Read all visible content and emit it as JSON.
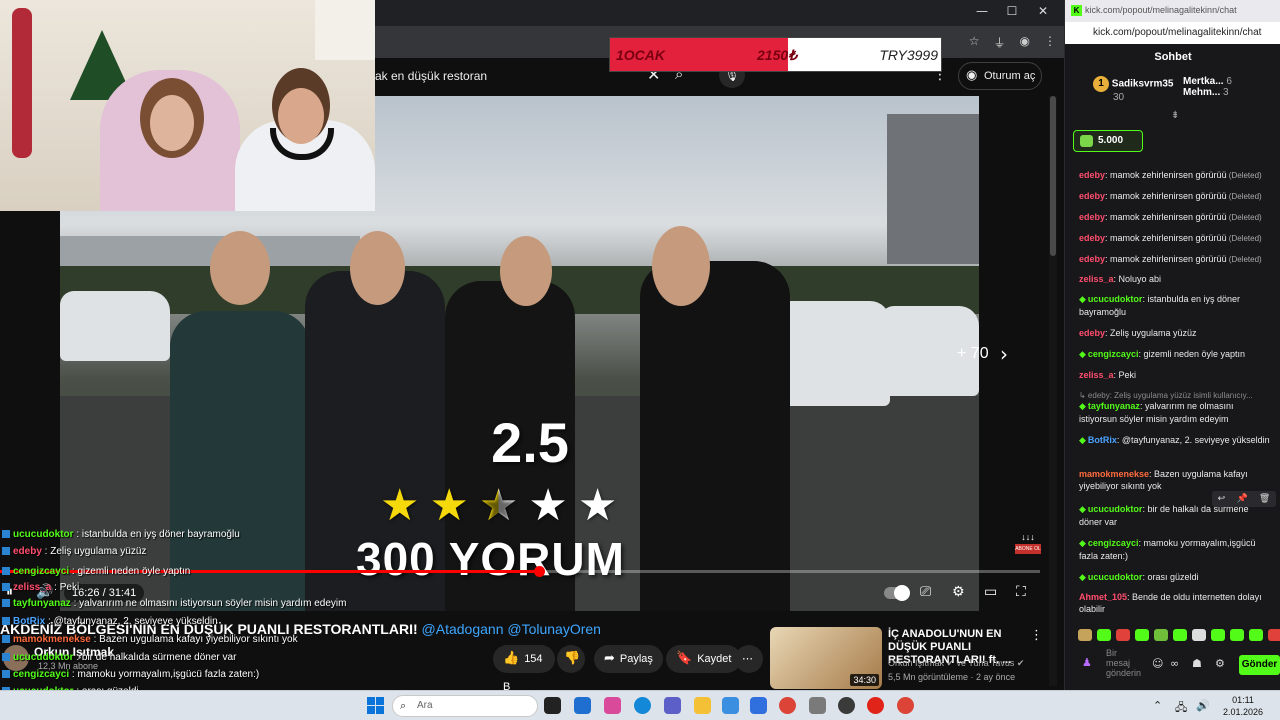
{
  "browser": {
    "window_controls": [
      "—",
      "☐",
      "✕"
    ],
    "toolbar_icons": [
      "☆",
      "⏚",
      "◉",
      "⋮"
    ]
  },
  "youtube": {
    "search_query": "ak en düşük restoran",
    "signin_label": "Oturum aç",
    "video": {
      "rating": "2.5",
      "stars": {
        "full": 2,
        "half": 1,
        "empty": 2
      },
      "reviews_text": "300 YORUM",
      "more_count": "+ 70",
      "subscribe_watermark": "ABONE OL",
      "time": "16:26 / 31:41",
      "progress_fraction": 0.518
    },
    "title_main": "AKDENİZ BÖLGESİ'NİN EN DÜŞÜK PUANLI RESTORANTLARI!",
    "title_mentions": "@Atadogann @TolunayOren",
    "channel": {
      "name": "Orkun Işıtmak",
      "subs": "12,3 Mn abone"
    },
    "actions": {
      "like_count": "154 B",
      "share": "Paylaş",
      "save": "Kaydet"
    },
    "recommendation": {
      "title": "İÇ ANADOLU'NUN EN DÜŞÜK PUANLI RESTORANTLARI! ft. ...",
      "channel": "Orkun Işıtmak ✔ ve Tuna Tavus ✔",
      "meta": "5,5 Mn görüntüleme · 2 ay önce",
      "duration": "34:30"
    }
  },
  "donation": {
    "month": "1OCAK",
    "amount": "2150₺",
    "goal": "TRY3999",
    "fraction": 0.5377,
    "color": "#e3213d"
  },
  "stream_overlay_chat": [
    {
      "user": "ucucudoktor",
      "text": ": istanbulda en iyş döner bayramoğlu",
      "color": "#53fc18"
    },
    {
      "user": "edeby",
      "text": ": Zeliş uygulama yüzüz",
      "color": "#ff4d6d"
    },
    {
      "user": "cengizcayci",
      "text": ": gizemli neden öyle yaptın",
      "color": "#53fc18"
    },
    {
      "user": "zeliss_a",
      "text": ": Peki",
      "color": "#ff4d6d"
    },
    {
      "user": "tayfunyanaz",
      "text": ": yalvarırım ne olmasını istiyorsun söyler misin yardım edeyim",
      "color": "#53fc18"
    },
    {
      "user": "BotRix",
      "text": ": @tayfunyanaz, 2. seviyeye yükseldin",
      "color": "#4aa3ff"
    },
    {
      "user": "mamokmenekse",
      "text": ": Bazen uygulama kafayı yiyebiliyor sıkıntı yok",
      "color": "#ff6b3d"
    },
    {
      "user": "ucucudoktor",
      "text": ": bir de halkalıda sürmene döner var",
      "color": "#53fc18"
    },
    {
      "user": "cengizcayci",
      "text": ": mamoku yormayalım,işgücü fazla zaten:)",
      "color": "#53fc18"
    },
    {
      "user": "ucucudoktor",
      "text": ": orası güzeldi",
      "color": "#53fc18"
    },
    {
      "user": "Ahmet_105",
      "text": ": Bende de oldu internetten dolayı olabilir",
      "color": "#ff4d6d"
    }
  ],
  "kick": {
    "url_top": "kick.com/popout/melinagalitekinn/chat",
    "url": "kick.com/popout/melinagalitekinn/chat",
    "header": "Sohbet",
    "leaderboard": [
      {
        "rank": "1",
        "name": "Sadiksvrm35",
        "value": "30"
      },
      {
        "name": "Mertka...",
        "value": "6"
      },
      {
        "name": "Mehm...",
        "value": "3"
      }
    ],
    "gift_amount": "5.000",
    "messages": [
      {
        "user": "edeby",
        "text": ": mamok zehirlenirsen görürüü",
        "deleted": "(Deleted)",
        "color": "#ff4d6d"
      },
      {
        "user": "edeby",
        "text": ": mamok zehirlenirsen görürüü",
        "deleted": "(Deleted)",
        "color": "#ff4d6d"
      },
      {
        "user": "edeby",
        "text": ": mamok zehirlenirsen görürüü",
        "deleted": "(Deleted)",
        "color": "#ff4d6d"
      },
      {
        "user": "edeby",
        "text": ": mamok zehirlenirsen görürüü",
        "deleted": "(Deleted)",
        "color": "#ff4d6d"
      },
      {
        "user": "edeby",
        "text": ": mamok zehirlenirsen görürüü",
        "deleted": "(Deleted)",
        "color": "#ff4d6d"
      },
      {
        "user": "zeliss_a",
        "text": ": Noluyo abi",
        "color": "#ff4d6d"
      },
      {
        "user": "ucucudoktor",
        "text": ": istanbulda en iyş döner bayramoğlu",
        "color": "#53fc18"
      },
      {
        "user": "edeby",
        "text": ": Zeliş uygulama yüzüz",
        "color": "#ff4d6d"
      },
      {
        "user": "cengizcayci",
        "text": ": gizemli neden öyle yaptın",
        "color": "#53fc18"
      },
      {
        "user": "zeliss_a",
        "text": ": Peki",
        "color": "#ff4d6d"
      },
      {
        "reply": "↳ edeby: Zeliş uygulama yüzüz isimli kullanıcıy..."
      },
      {
        "user": "tayfunyanaz",
        "text": ": yalvarırım ne olmasını istiyorsun söyler misin yardım edeyim",
        "color": "#53fc18"
      },
      {
        "user": "BotRix",
        "text": ": @tayfunyanaz, 2. seviyeye yükseldin",
        "color": "#4aa3ff"
      },
      {
        "user": "mamokmenekse",
        "text": ": Bazen uygulama kafayı yiyebiliyor sıkıntı yok",
        "color": "#ff6b3d"
      },
      {
        "user": "ucucudoktor",
        "text": ": bir de halkalı da sürmene döner var",
        "color": "#53fc18"
      },
      {
        "user": "cengizcayci",
        "text": ": mamoku yormayalım,işgücü fazla zaten:)",
        "color": "#53fc18"
      },
      {
        "user": "ucucudoktor",
        "text": ": orası güzeldi",
        "color": "#53fc18"
      },
      {
        "user": "Ahmet_105",
        "text": ": Bende de oldu internetten dolayı olabilir",
        "color": "#ff4d6d"
      }
    ],
    "input_placeholder": "Bir mesaj gönderin",
    "send_label": "Gönder",
    "accent": "#53fc18"
  },
  "taskbar": {
    "search_placeholder": "Ara",
    "time": "01:11",
    "date": "2.01.2026"
  }
}
